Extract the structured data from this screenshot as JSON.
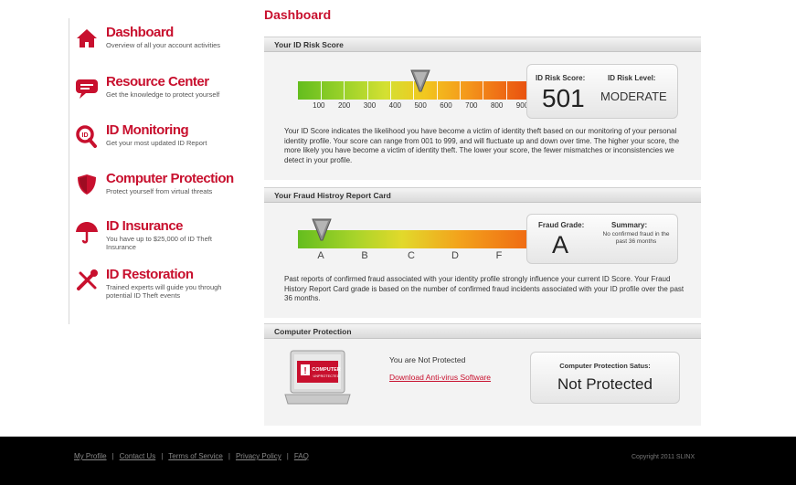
{
  "nav": [
    {
      "title": "Dashboard",
      "desc": "Overview of all your account activities"
    },
    {
      "title": "Resource Center",
      "desc": "Get the knowledge to protect yourself"
    },
    {
      "title": "ID Monitoring",
      "desc": "Get your most updated ID Report"
    },
    {
      "title": "Computer Protection",
      "desc": "Protect yourself from virtual threats"
    },
    {
      "title": "ID Insurance",
      "desc": "You have up to $25,000 of ID Theft Insurance"
    },
    {
      "title": "ID Restoration",
      "desc": "Trained experts will guide you through potential ID Theft events"
    }
  ],
  "page_title": "Dashboard",
  "risk": {
    "heading": "Your ID Risk Score",
    "ticks": [
      "100",
      "200",
      "300",
      "400",
      "500",
      "600",
      "700",
      "800",
      "900"
    ],
    "score_label": "ID Risk Score:",
    "level_label": "ID Risk Level:",
    "score": "501",
    "level": "MODERATE",
    "pointer_value": 501,
    "paragraph": "Your ID Score indicates the likelihood you have become a victim of identity theft based on our monitoring of your personal identity profile. Your score can range from 001 to 999, and will fluctuate up and down over time. The higher your score, the more likely you have become a victim of identity theft. The lower your score, the fewer mismatches or inconsistencies we detect in your profile."
  },
  "fraud": {
    "heading": "Your Fraud Histroy Report Card",
    "grades": [
      "A",
      "B",
      "C",
      "D",
      "F"
    ],
    "grade_label": "Fraud Grade:",
    "summary_label": "Summary:",
    "grade": "A",
    "summary": "No confirmed fraud in the past 36 months",
    "paragraph": "Past reports of confirmed fraud associated with your identity profile strongly influence your current ID Score. Your Fraud History Report Card grade is based on the number of confirmed fraud incidents associated with your ID profile over the past 36 months."
  },
  "protection": {
    "heading": "Computer Protection",
    "screen_line1": "COMPUTER",
    "screen_line2": "UNPROTECTED",
    "status_text": "You are Not Protected",
    "download_link": "Download Anti-virus Software",
    "box_label": "Computer Protection Satus:",
    "box_value": "Not Protected"
  },
  "footer": {
    "links": [
      "My Profile",
      "Contact Us",
      "Terms of Service",
      "Privacy Policy",
      "FAQ"
    ],
    "copyright": "Copyright 2011 SLINX"
  },
  "colors": {
    "brand_red": "#c8102e",
    "footer_bg": "#000000"
  }
}
